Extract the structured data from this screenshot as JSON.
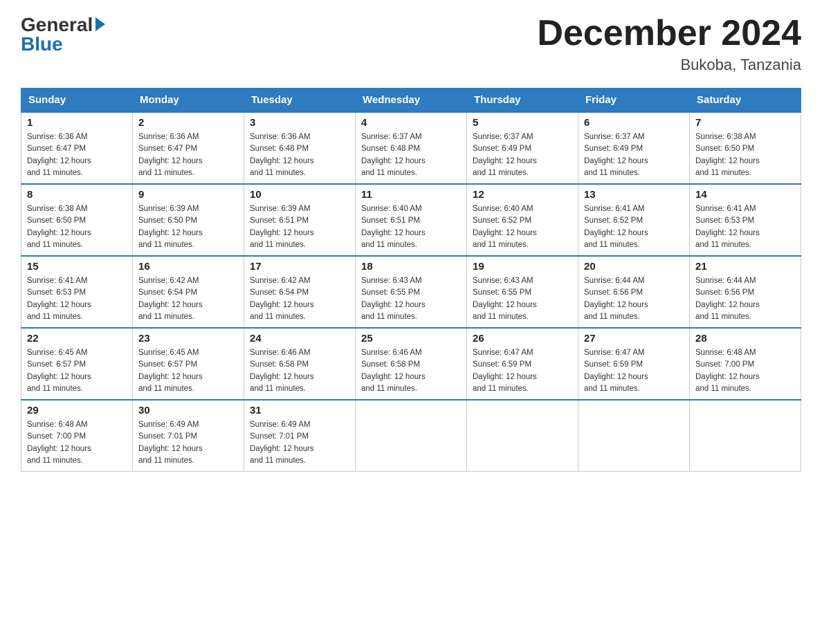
{
  "logo": {
    "general": "General",
    "blue": "Blue"
  },
  "title": {
    "month_year": "December 2024",
    "location": "Bukoba, Tanzania"
  },
  "weekdays": [
    "Sunday",
    "Monday",
    "Tuesday",
    "Wednesday",
    "Thursday",
    "Friday",
    "Saturday"
  ],
  "weeks": [
    [
      {
        "day": 1,
        "sunrise": "6:36 AM",
        "sunset": "6:47 PM",
        "daylight": "12 hours and 11 minutes."
      },
      {
        "day": 2,
        "sunrise": "6:36 AM",
        "sunset": "6:47 PM",
        "daylight": "12 hours and 11 minutes."
      },
      {
        "day": 3,
        "sunrise": "6:36 AM",
        "sunset": "6:48 PM",
        "daylight": "12 hours and 11 minutes."
      },
      {
        "day": 4,
        "sunrise": "6:37 AM",
        "sunset": "6:48 PM",
        "daylight": "12 hours and 11 minutes."
      },
      {
        "day": 5,
        "sunrise": "6:37 AM",
        "sunset": "6:49 PM",
        "daylight": "12 hours and 11 minutes."
      },
      {
        "day": 6,
        "sunrise": "6:37 AM",
        "sunset": "6:49 PM",
        "daylight": "12 hours and 11 minutes."
      },
      {
        "day": 7,
        "sunrise": "6:38 AM",
        "sunset": "6:50 PM",
        "daylight": "12 hours and 11 minutes."
      }
    ],
    [
      {
        "day": 8,
        "sunrise": "6:38 AM",
        "sunset": "6:50 PM",
        "daylight": "12 hours and 11 minutes."
      },
      {
        "day": 9,
        "sunrise": "6:39 AM",
        "sunset": "6:50 PM",
        "daylight": "12 hours and 11 minutes."
      },
      {
        "day": 10,
        "sunrise": "6:39 AM",
        "sunset": "6:51 PM",
        "daylight": "12 hours and 11 minutes."
      },
      {
        "day": 11,
        "sunrise": "6:40 AM",
        "sunset": "6:51 PM",
        "daylight": "12 hours and 11 minutes."
      },
      {
        "day": 12,
        "sunrise": "6:40 AM",
        "sunset": "6:52 PM",
        "daylight": "12 hours and 11 minutes."
      },
      {
        "day": 13,
        "sunrise": "6:41 AM",
        "sunset": "6:52 PM",
        "daylight": "12 hours and 11 minutes."
      },
      {
        "day": 14,
        "sunrise": "6:41 AM",
        "sunset": "6:53 PM",
        "daylight": "12 hours and 11 minutes."
      }
    ],
    [
      {
        "day": 15,
        "sunrise": "6:41 AM",
        "sunset": "6:53 PM",
        "daylight": "12 hours and 11 minutes."
      },
      {
        "day": 16,
        "sunrise": "6:42 AM",
        "sunset": "6:54 PM",
        "daylight": "12 hours and 11 minutes."
      },
      {
        "day": 17,
        "sunrise": "6:42 AM",
        "sunset": "6:54 PM",
        "daylight": "12 hours and 11 minutes."
      },
      {
        "day": 18,
        "sunrise": "6:43 AM",
        "sunset": "6:55 PM",
        "daylight": "12 hours and 11 minutes."
      },
      {
        "day": 19,
        "sunrise": "6:43 AM",
        "sunset": "6:55 PM",
        "daylight": "12 hours and 11 minutes."
      },
      {
        "day": 20,
        "sunrise": "6:44 AM",
        "sunset": "6:56 PM",
        "daylight": "12 hours and 11 minutes."
      },
      {
        "day": 21,
        "sunrise": "6:44 AM",
        "sunset": "6:56 PM",
        "daylight": "12 hours and 11 minutes."
      }
    ],
    [
      {
        "day": 22,
        "sunrise": "6:45 AM",
        "sunset": "6:57 PM",
        "daylight": "12 hours and 11 minutes."
      },
      {
        "day": 23,
        "sunrise": "6:45 AM",
        "sunset": "6:57 PM",
        "daylight": "12 hours and 11 minutes."
      },
      {
        "day": 24,
        "sunrise": "6:46 AM",
        "sunset": "6:58 PM",
        "daylight": "12 hours and 11 minutes."
      },
      {
        "day": 25,
        "sunrise": "6:46 AM",
        "sunset": "6:58 PM",
        "daylight": "12 hours and 11 minutes."
      },
      {
        "day": 26,
        "sunrise": "6:47 AM",
        "sunset": "6:59 PM",
        "daylight": "12 hours and 11 minutes."
      },
      {
        "day": 27,
        "sunrise": "6:47 AM",
        "sunset": "6:59 PM",
        "daylight": "12 hours and 11 minutes."
      },
      {
        "day": 28,
        "sunrise": "6:48 AM",
        "sunset": "7:00 PM",
        "daylight": "12 hours and 11 minutes."
      }
    ],
    [
      {
        "day": 29,
        "sunrise": "6:48 AM",
        "sunset": "7:00 PM",
        "daylight": "12 hours and 11 minutes."
      },
      {
        "day": 30,
        "sunrise": "6:49 AM",
        "sunset": "7:01 PM",
        "daylight": "12 hours and 11 minutes."
      },
      {
        "day": 31,
        "sunrise": "6:49 AM",
        "sunset": "7:01 PM",
        "daylight": "12 hours and 11 minutes."
      },
      null,
      null,
      null,
      null
    ]
  ],
  "labels": {
    "sunrise": "Sunrise:",
    "sunset": "Sunset:",
    "daylight": "Daylight:"
  }
}
